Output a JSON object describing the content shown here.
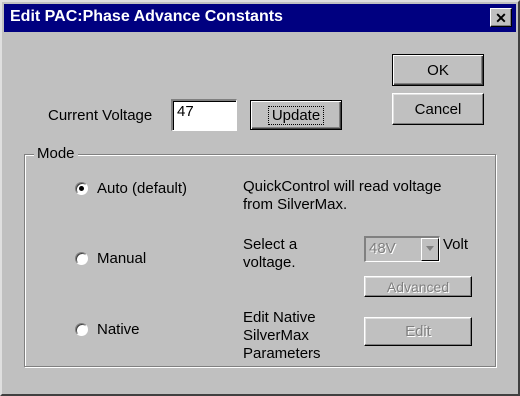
{
  "window": {
    "title": "Edit PAC:Phase Advance Constants",
    "close_glyph": "✕"
  },
  "buttons": {
    "ok": "OK",
    "cancel": "Cancel",
    "update": "Update",
    "advanced": "Advanced",
    "edit": "Edit"
  },
  "voltage": {
    "label": "Current Voltage",
    "value": "47"
  },
  "mode": {
    "group_label": "Mode",
    "selected": "auto",
    "options": [
      {
        "id": "auto",
        "label": "Auto (default)",
        "description": [
          "QuickControl will read voltage",
          "from SilverMax."
        ]
      },
      {
        "id": "manual",
        "label": "Manual",
        "description": [
          "Select a",
          "voltage."
        ]
      },
      {
        "id": "native",
        "label": "Native",
        "description": [
          "Edit Native",
          "SilverMax",
          "Parameters"
        ]
      }
    ]
  },
  "voltage_select": {
    "value": "48V",
    "unit": "Volt"
  }
}
